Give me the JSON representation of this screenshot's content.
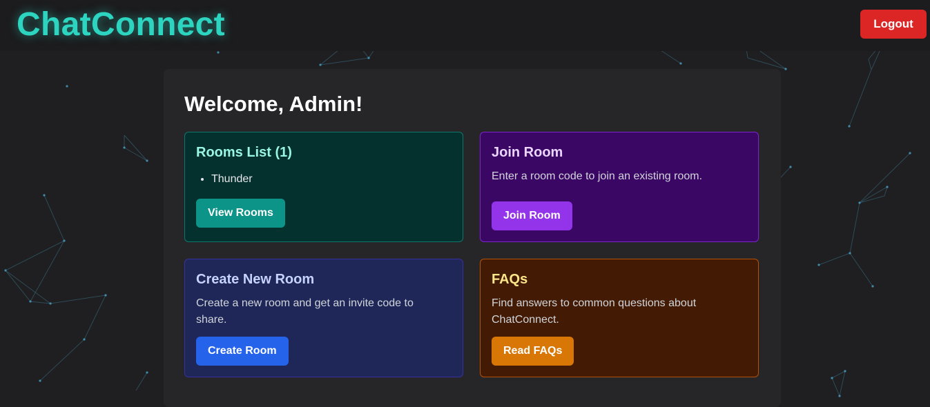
{
  "app": {
    "brand": "ChatConnect",
    "logout_label": "Logout"
  },
  "main": {
    "welcome": "Welcome, Admin!",
    "rooms_card": {
      "title": "Rooms List (1)",
      "rooms": [
        "Thunder"
      ],
      "button": "View Rooms"
    },
    "join_card": {
      "title": "Join Room",
      "description": "Enter a room code to join an existing room.",
      "button": "Join Room"
    },
    "create_card": {
      "title": "Create New Room",
      "description": "Create a new room and get an invite code to share.",
      "button": "Create Room"
    },
    "faq_card": {
      "title": "FAQs",
      "description": "Find answers to common questions about ChatConnect.",
      "button": "Read FAQs"
    }
  },
  "colors": {
    "accent": "#2dd4bf",
    "logout": "#dc2626",
    "rooms_button": "#0d9488",
    "join_button": "#9333ea",
    "create_button": "#2563eb",
    "faq_button": "#d97706"
  }
}
